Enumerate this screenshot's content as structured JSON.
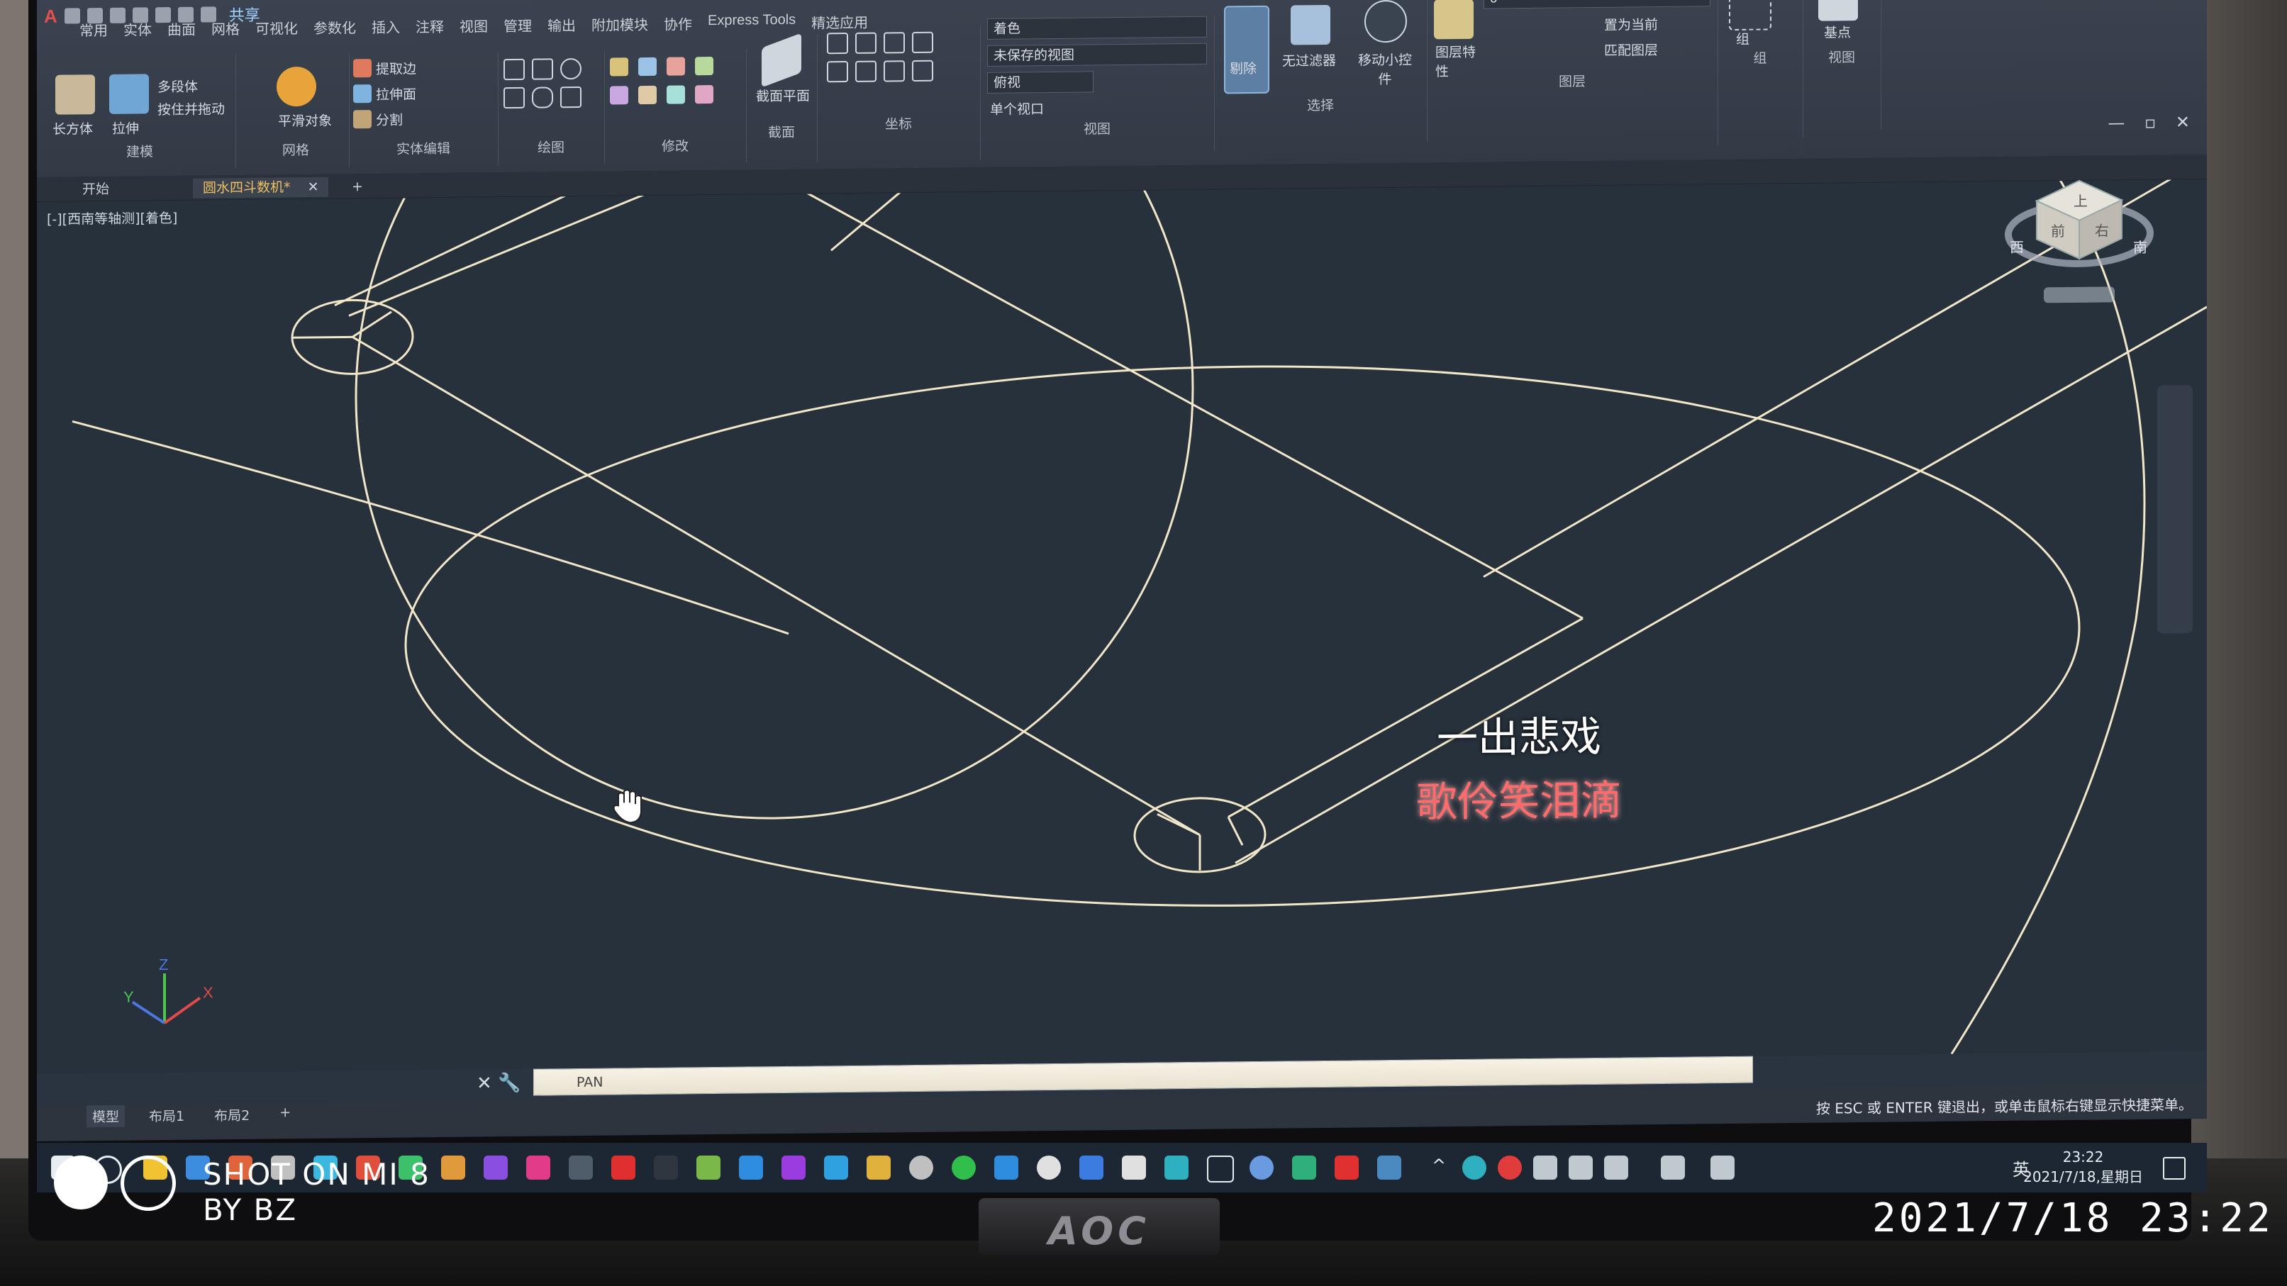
{
  "app": {
    "qat_share": "共享",
    "menu_tabs": [
      "常用",
      "实体",
      "曲面",
      "网格",
      "可视化",
      "参数化",
      "插入",
      "注释",
      "视图",
      "管理",
      "输出",
      "附加模块",
      "协作",
      "Express Tools",
      "精选应用"
    ]
  },
  "ribbon": {
    "panels": {
      "modeling": {
        "title": "建模",
        "tools": [
          "长方体",
          "拉伸",
          "多段体",
          "按住并拖动"
        ]
      },
      "mesh": {
        "title": "网格",
        "tools": [
          "平滑对象"
        ]
      },
      "solid_edit": {
        "title": "实体编辑",
        "tools": [
          "提取边",
          "拉伸面",
          "分割"
        ]
      },
      "draw": {
        "title": "绘图"
      },
      "modify": {
        "title": "修改"
      },
      "section": {
        "title": "截面",
        "tools": [
          "截面平面"
        ]
      },
      "coordinates": {
        "title": "坐标"
      },
      "view": {
        "title": "视图",
        "visual_style": "着色",
        "saved_view": "未保存的视图",
        "view_dir": "俯视",
        "viewport": "单个视口"
      },
      "selection": {
        "title": "选择",
        "tools": [
          "剔除",
          "无过滤器",
          "移动小控件"
        ]
      },
      "layers": {
        "title": "图层",
        "tools": [
          "图层特性",
          "置为当前",
          "匹配图层"
        ],
        "layer_value": "0"
      },
      "groups": {
        "title": "组",
        "tools": [
          "组"
        ]
      },
      "view2": {
        "title": "视图",
        "tools": [
          "基点"
        ]
      }
    }
  },
  "doc_tabs": {
    "start": "开始",
    "drawing": "圆水四斗数机*",
    "new_tab": "+"
  },
  "viewport": {
    "label": "[-][西南等轴测][着色]",
    "win_buttons": "— ▫ ✕",
    "viewcube": {
      "top": "上",
      "front": "前",
      "right": "右",
      "ring_w": "西",
      "ring_s": "南"
    },
    "ucs": {
      "x": "X",
      "y": "Y",
      "z": "Z"
    }
  },
  "subtitle": {
    "line1": "一出悲戏",
    "line2": "歌伶笑泪滴"
  },
  "command": {
    "text": "PAN",
    "close": "✕",
    "settings": "🔧"
  },
  "layout_tabs": [
    "模型",
    "布局1",
    "布局2",
    "+"
  ],
  "status": {
    "hint": "按 ESC 或 ENTER 键退出，或单击鼠标右键显示快捷菜单。"
  },
  "taskbar": {
    "lang": "英",
    "time": "23:22",
    "date": "2021/7/18,星期日"
  },
  "monitor": {
    "brand": "AOC"
  },
  "photo_watermark": {
    "line1": "SHOT ON MI 8",
    "line2": "BY BZ",
    "timestamp": "2021/7/18  23:22"
  }
}
